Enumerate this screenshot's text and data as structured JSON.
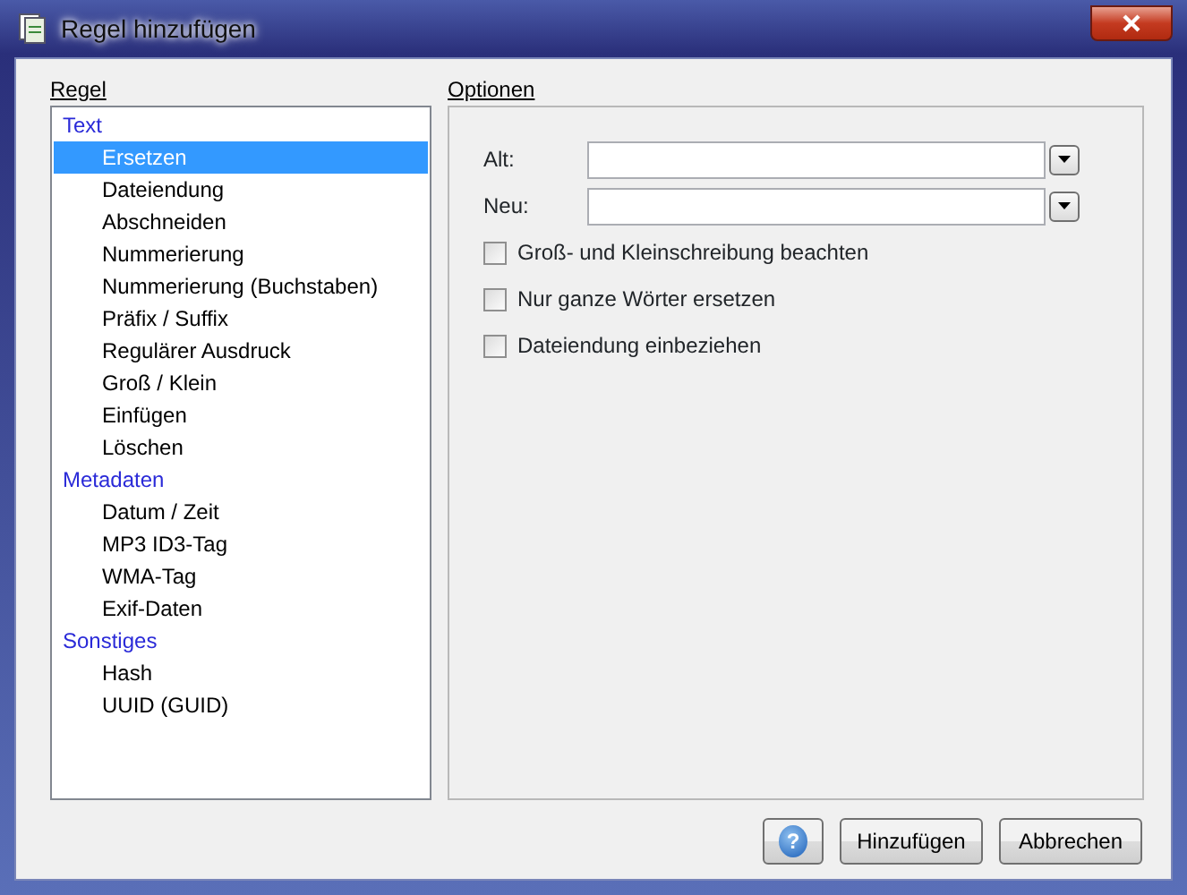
{
  "window": {
    "title": "Regel hinzufügen"
  },
  "rule_panel": {
    "label": "Regel",
    "tree": [
      {
        "label": "Text",
        "selected": false,
        "children": [
          {
            "label": "Ersetzen",
            "selected": true
          },
          {
            "label": "Dateiendung",
            "selected": false
          },
          {
            "label": "Abschneiden",
            "selected": false
          },
          {
            "label": "Nummerierung",
            "selected": false
          },
          {
            "label": "Nummerierung (Buchstaben)",
            "selected": false
          },
          {
            "label": "Präfix / Suffix",
            "selected": false
          },
          {
            "label": "Regulärer Ausdruck",
            "selected": false
          },
          {
            "label": "Groß / Klein",
            "selected": false
          },
          {
            "label": "Einfügen",
            "selected": false
          },
          {
            "label": "Löschen",
            "selected": false
          }
        ]
      },
      {
        "label": "Metadaten",
        "selected": false,
        "children": [
          {
            "label": "Datum / Zeit",
            "selected": false
          },
          {
            "label": "MP3 ID3-Tag",
            "selected": false
          },
          {
            "label": "WMA-Tag",
            "selected": false
          },
          {
            "label": "Exif-Daten",
            "selected": false
          }
        ]
      },
      {
        "label": "Sonstiges",
        "selected": false,
        "children": [
          {
            "label": "Hash",
            "selected": false
          },
          {
            "label": "UUID (GUID)",
            "selected": false
          }
        ]
      }
    ]
  },
  "options_panel": {
    "label": "Optionen",
    "fields": [
      {
        "label": "Alt:"
      },
      {
        "label": "Neu:"
      }
    ],
    "checkboxes": [
      {
        "label": "Groß- und Kleinschreibung beachten",
        "checked": false
      },
      {
        "label": "Nur ganze Wörter ersetzen",
        "checked": false
      },
      {
        "label": "Dateiendung einbeziehen",
        "checked": false
      }
    ]
  },
  "buttons": [
    {
      "kind": "help",
      "label": "?"
    },
    {
      "kind": "text",
      "label": "Hinzufügen"
    },
    {
      "kind": "text",
      "label": "Abbrechen"
    }
  ]
}
